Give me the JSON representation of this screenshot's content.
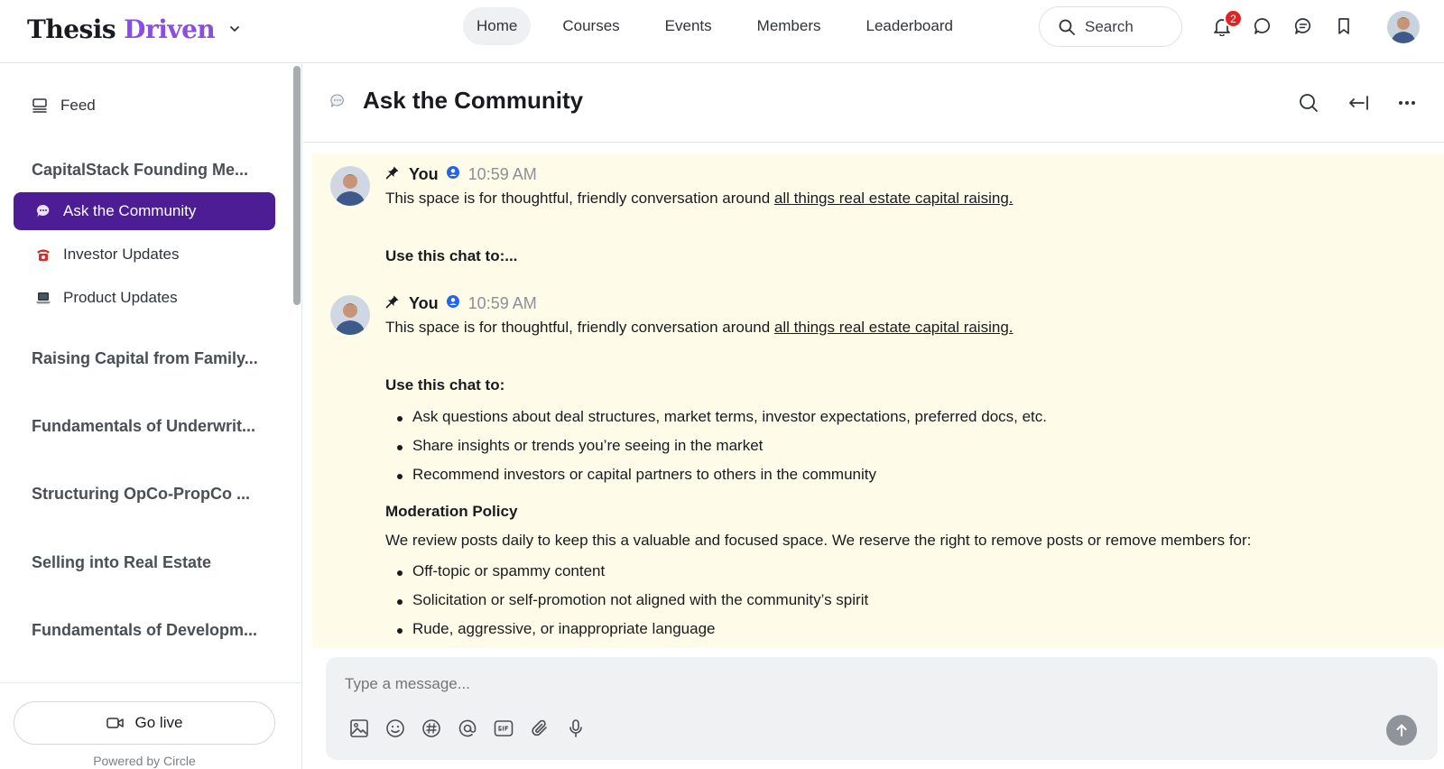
{
  "brand": {
    "part1": "Thesis",
    "part2": "Driven"
  },
  "nav": {
    "items": [
      "Home",
      "Courses",
      "Events",
      "Members",
      "Leaderboard"
    ],
    "active": "Home"
  },
  "search": {
    "label": "Search"
  },
  "notifications": {
    "count": "2"
  },
  "colors": {
    "accent": "#4c1d95",
    "brand_purple": "#8a4fe0",
    "chat_bg": "#fefce8",
    "badge": "#e02424"
  },
  "sidebar": {
    "feed_label": "Feed",
    "groups": [
      "CapitalStack Founding Me...",
      "Raising Capital from Family...",
      "Fundamentals of Underwrit...",
      "Structuring OpCo-PropCo ...",
      "Selling into Real Estate",
      "Fundamentals of Developm..."
    ],
    "items": [
      {
        "label": "Ask the Community",
        "icon": "speech-bubble-icon",
        "active": true
      },
      {
        "label": "Investor Updates",
        "icon": "telephone-icon",
        "active": false
      },
      {
        "label": "Product Updates",
        "icon": "laptop-icon",
        "active": false
      }
    ],
    "go_live": "Go live",
    "powered_by": "Powered by Circle"
  },
  "channel": {
    "title": "Ask the Community"
  },
  "messages": [
    {
      "author": "You",
      "time": "10:59 AM",
      "intro": "This space is for thoughtful, friendly conversation around ",
      "link": "all things real estate capital raising.",
      "truncated_heading": "Use this chat to:..."
    },
    {
      "author": "You",
      "time": "10:59 AM",
      "intro": "This space is for thoughtful, friendly conversation around ",
      "link": "all things real estate capital raising.",
      "heading": "Use this chat to:",
      "bullets": [
        "Ask questions about deal structures, market terms, investor expectations, preferred docs, etc.",
        "Share insights or trends you’re seeing in the market",
        "Recommend investors or capital partners to others in the community"
      ],
      "policy_heading": "Moderation Policy",
      "policy_text": "We review posts daily to keep this a valuable and focused space. We reserve the right to remove posts or remove members for:",
      "policy_bullets": [
        "Off-topic or spammy content",
        "Solicitation or self-promotion not aligned with the community’s spirit",
        "Rude, aggressive, or inappropriate language"
      ]
    }
  ],
  "composer": {
    "placeholder": "Type a message..."
  }
}
